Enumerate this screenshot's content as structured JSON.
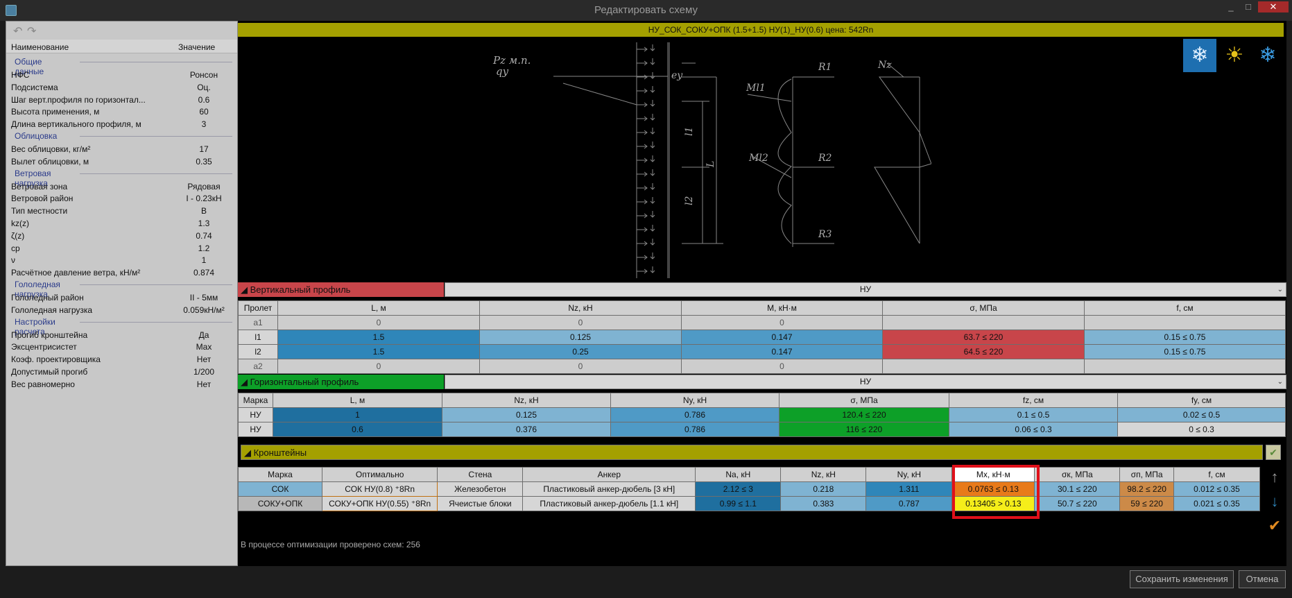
{
  "window": {
    "title": "Редактировать схему",
    "min": "_",
    "max": "□",
    "close": "✕"
  },
  "left_panel": {
    "undo": "↶",
    "redo": "↷",
    "header": {
      "name": "Наименование",
      "value": "Значение"
    },
    "groups": [
      {
        "title": "Общие данные",
        "items": [
          {
            "k": "НФС",
            "v": "Ронсон"
          },
          {
            "k": "Подсистема",
            "v": "Оц."
          },
          {
            "k": "Шаг верт.профиля по горизонтал...",
            "v": "0.6"
          },
          {
            "k": "Высота применения, м",
            "v": "60"
          },
          {
            "k": "Длина вертикального профиля, м",
            "v": "3"
          }
        ]
      },
      {
        "title": "Облицовка",
        "items": [
          {
            "k": "Вес облицовки, кг/м²",
            "v": "17"
          },
          {
            "k": "Вылет облицовки, м",
            "v": "0.35"
          }
        ]
      },
      {
        "title": "Ветровая нагрузка",
        "items": [
          {
            "k": "Ветровая зона",
            "v": "Рядовая"
          },
          {
            "k": "Ветровой район",
            "v": "I - 0.23кН"
          },
          {
            "k": "Тип местности",
            "v": "В"
          },
          {
            "k": "kz(z)",
            "v": "1.3"
          },
          {
            "k": "ζ(z)",
            "v": "0.74"
          },
          {
            "k": "cp",
            "v": "1.2"
          },
          {
            "k": "ν",
            "v": "1"
          },
          {
            "k": "Расчётное давление ветра, кН/м²",
            "v": "0.874"
          }
        ]
      },
      {
        "title": "Гололедная нагрузка",
        "items": [
          {
            "k": "Гололедный район",
            "v": "II - 5мм"
          },
          {
            "k": "Гололедная нагрузка",
            "v": "0.059кН/м²"
          }
        ]
      },
      {
        "title": "Настройки расчета",
        "items": [
          {
            "k": "Прогиб кронштейна",
            "v": "Да"
          },
          {
            "k": "Эксцентрисистет",
            "v": "Max"
          },
          {
            "k": "Коэф. проектировщика",
            "v": "Нет"
          },
          {
            "k": "Допустимый прогиб",
            "v": "1/200"
          },
          {
            "k": "Вес равномерно",
            "v": "Нет"
          }
        ]
      }
    ]
  },
  "banner": "НУ_СОК_СОКУ+ОПК (1.5+1.5) НУ(1)_НУ(0.6) цена: 542Rn",
  "modes": {
    "winter_sun": "❄",
    "sun": "☀",
    "snow": "❄"
  },
  "diagram": {
    "pz": "Pz м.п.",
    "qy": "qy",
    "ey": "ey",
    "l1": "l1",
    "l2": "l2",
    "L": "L",
    "ml1": "Ml1",
    "ml2": "Ml2",
    "r1": "R1",
    "r2": "R2",
    "r3": "R3",
    "nz": "Nz"
  },
  "vertical": {
    "label": "◢ Вертикальный профиль",
    "select": "НУ",
    "headers": [
      "Пролет",
      "L, м",
      "Nz, кН",
      "M, кН·м",
      "σ, МПа",
      "f, см"
    ],
    "rows": [
      [
        "a1",
        "0",
        "0",
        "0",
        "",
        ""
      ],
      [
        "l1",
        "1.5",
        "0.125",
        "0.147",
        "63.7 ≤ 220",
        "0.15 ≤ 0.75"
      ],
      [
        "l2",
        "1.5",
        "0.25",
        "0.147",
        "64.5 ≤ 220",
        "0.15 ≤ 0.75"
      ],
      [
        "a2",
        "0",
        "0",
        "0",
        "",
        ""
      ]
    ]
  },
  "horizontal": {
    "label": "◢ Горизонтальный профиль",
    "select": "НУ",
    "headers": [
      "Марка",
      "L, м",
      "Nz, кН",
      "Ny, кН",
      "σ, МПа",
      "fz, см",
      "fy, см"
    ],
    "rows": [
      [
        "НУ",
        "1",
        "0.125",
        "0.786",
        "120.4 ≤ 220",
        "0.1 ≤ 0.5",
        "0.02 ≤ 0.5"
      ],
      [
        "НУ",
        "0.6",
        "0.376",
        "0.786",
        "116 ≤ 220",
        "0.06 ≤ 0.3",
        "0 ≤ 0.3"
      ]
    ]
  },
  "brackets": {
    "label": "◢ Кронштейны",
    "headers": [
      "Марка",
      "Оптимально",
      "Стена",
      "Анкер",
      "Na, кН",
      "Nz, кН",
      "Ny, кН",
      "Mx, кН·м",
      "σк, МПа",
      "σп, МПа",
      "f, см"
    ],
    "rows": [
      [
        "СОК",
        "СОК НУ(0.8) ⁺8Rn",
        "Железобетон",
        "Пластиковый анкер-дюбель [3 кН]",
        "2.12 ≤ 3",
        "0.218",
        "1.311",
        "0.0763 ≤ 0.13",
        "30.1 ≤ 220",
        "98.2 ≤ 220",
        "0.012 ≤ 0.35"
      ],
      [
        "СОКУ+ОПК",
        "СОКУ+ОПК НУ(0.55) ⁺8Rn",
        "Ячеистые блоки",
        "Пластиковый анкер-дюбель [1.1 кН]",
        "0.99 ≤ 1.1",
        "0.383",
        "0.787",
        "0.13405 > 0.13",
        "50.7 ≤ 220",
        "59 ≤ 220",
        "0.021 ≤ 0.35"
      ]
    ],
    "side": {
      "up": "↑",
      "down": "↓",
      "check": "✔"
    }
  },
  "status": "В процессе оптимизации проверено схем: 256",
  "buttons": {
    "save": "Сохранить изменения",
    "cancel": "Отмена"
  }
}
